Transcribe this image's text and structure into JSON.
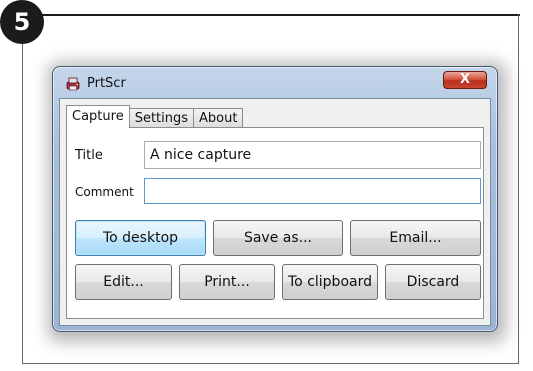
{
  "step_number": "5",
  "window": {
    "title": "PrtScr",
    "close_glyph": "X",
    "icon": "prtscr-app-icon",
    "accent": "#4a5a72"
  },
  "tabs": [
    {
      "label": "Capture",
      "active": true
    },
    {
      "label": "Settings",
      "active": false
    },
    {
      "label": "About",
      "active": false
    }
  ],
  "form": {
    "title_label": "Title",
    "title_value": "A nice capture",
    "comment_label": "Comment",
    "comment_value": ""
  },
  "buttons": {
    "to_desktop": "To desktop",
    "save_as": "Save as...",
    "email": "Email...",
    "edit": "Edit...",
    "print": "Print...",
    "to_clipboard": "To clipboard",
    "discard": "Discard"
  }
}
